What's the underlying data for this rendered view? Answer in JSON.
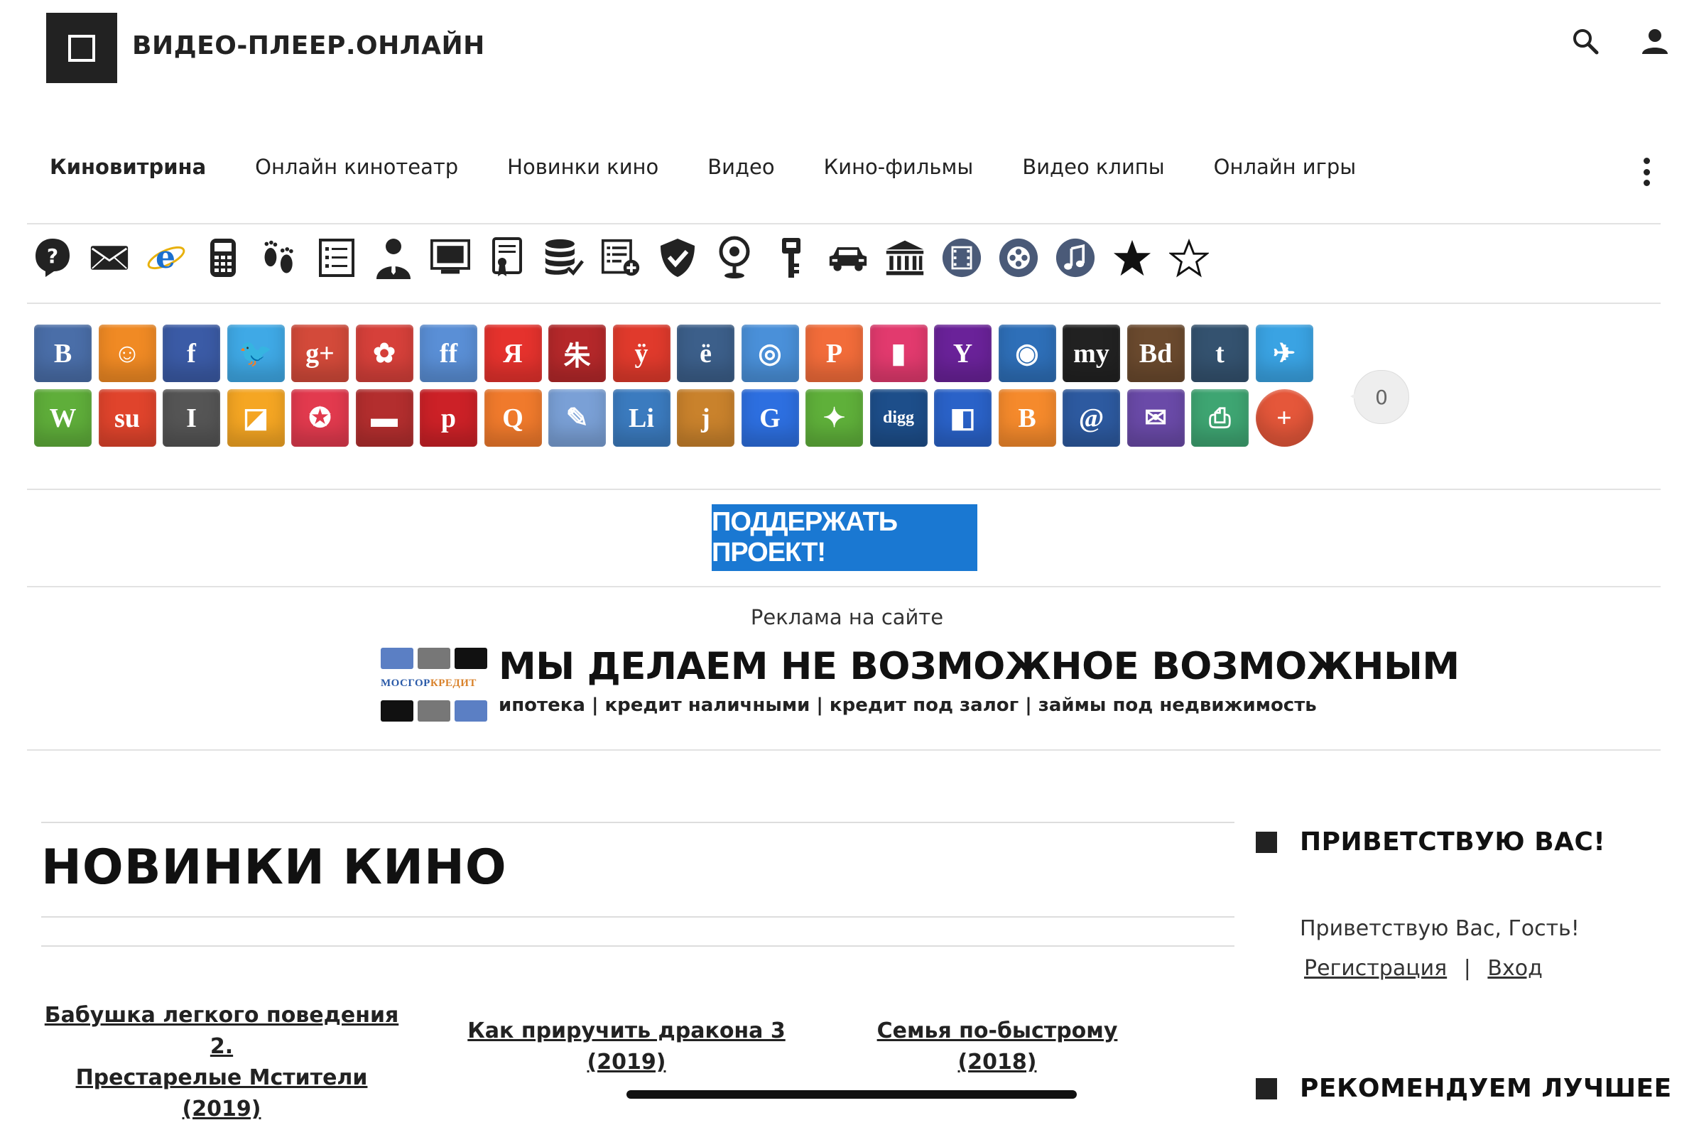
{
  "header": {
    "site_title": "ВИДЕО-ПЛЕЕР.ОНЛАЙН",
    "search_icon": "search-icon",
    "user_icon": "user-icon"
  },
  "nav": {
    "items": [
      "Киновитрина",
      "Онлайн кинотеатр",
      "Новинки кино",
      "Видео",
      "Кино-фильмы",
      "Видео клипы",
      "Онлайн игры"
    ],
    "active": "Киновитрина"
  },
  "tools": [
    "help-icon",
    "mail-icon",
    "ie-icon",
    "calculator-icon",
    "footprints-icon",
    "list-icon",
    "person-icon",
    "monitor-icon",
    "certificate-icon",
    "database-icon",
    "list-add-icon",
    "check-shield-icon",
    "location-icon",
    "key-icon",
    "car-icon",
    "bank-icon",
    "film-icon",
    "reel-icon",
    "music-icon",
    "star-filled-icon",
    "star-outline-icon"
  ],
  "share": {
    "buttons": [
      {
        "name": "vkontakte",
        "glyph": "B",
        "color": "#4a6ea8"
      },
      {
        "name": "odnoklassniki",
        "glyph": "☺",
        "color": "#f08a24"
      },
      {
        "name": "facebook",
        "glyph": "f",
        "color": "#3b5ba6"
      },
      {
        "name": "twitter",
        "glyph": "🐦",
        "color": "#3fa9e6"
      },
      {
        "name": "google-plus",
        "glyph": "g+",
        "color": "#d34a3a"
      },
      {
        "name": "moi-mir",
        "glyph": "✿",
        "color": "#d6403a"
      },
      {
        "name": "friendfeed",
        "glyph": "ff",
        "color": "#5a8fd6"
      },
      {
        "name": "yandex",
        "glyph": "Я",
        "color": "#e5322d"
      },
      {
        "name": "surfingbird",
        "glyph": "朱",
        "color": "#b5282a"
      },
      {
        "name": "liveinternet",
        "glyph": "ÿ",
        "color": "#e03a2c"
      },
      {
        "name": "yo",
        "glyph": "ё",
        "color": "#3c5f8a"
      },
      {
        "name": "evernote-web",
        "glyph": "◎",
        "color": "#4a90d9"
      },
      {
        "name": "pinme",
        "glyph": "P",
        "color": "#f26c3a"
      },
      {
        "name": "bookmark",
        "glyph": "▮",
        "color": "#e23a6e"
      },
      {
        "name": "yahoo",
        "glyph": "Y",
        "color": "#6a2299"
      },
      {
        "name": "webmoney",
        "glyph": "◉",
        "color": "#2e6fb8"
      },
      {
        "name": "my",
        "glyph": "my",
        "color": "#222222"
      },
      {
        "name": "bobrdobr",
        "glyph": "Bd",
        "color": "#6b4a2e"
      },
      {
        "name": "tumblr",
        "glyph": "t",
        "color": "#34526f"
      },
      {
        "name": "hitomi",
        "glyph": "✈",
        "color": "#3aa3e3"
      },
      {
        "name": "wordpress",
        "glyph": "W",
        "color": "#5fae3a"
      },
      {
        "name": "stumbleupon",
        "glyph": "su",
        "color": "#e0442c"
      },
      {
        "name": "instapaper",
        "glyph": "I",
        "color": "#555555"
      },
      {
        "name": "feed",
        "glyph": "◪",
        "color": "#f5a623"
      },
      {
        "name": "circle-star",
        "glyph": "✪",
        "color": "#e23a4e"
      },
      {
        "name": "sofa",
        "glyph": "▬",
        "color": "#b32e2e"
      },
      {
        "name": "pinterest",
        "glyph": "p",
        "color": "#cc2127"
      },
      {
        "name": "search-q",
        "glyph": "Q",
        "color": "#f07a2c"
      },
      {
        "name": "pencil",
        "glyph": "✎",
        "color": "#7aa0d6"
      },
      {
        "name": "linkedin",
        "glyph": "Li",
        "color": "#3b7bbf"
      },
      {
        "name": "juick",
        "glyph": "j",
        "color": "#c9822c"
      },
      {
        "name": "google",
        "glyph": "G",
        "color": "#2d6fe0"
      },
      {
        "name": "evernote",
        "glyph": "✦",
        "color": "#5fb03a"
      },
      {
        "name": "digg",
        "glyph": "digg",
        "color": "#1d4e8a"
      },
      {
        "name": "delicious",
        "glyph": "◧",
        "color": "#2a62c8"
      },
      {
        "name": "blogger",
        "glyph": "B",
        "color": "#f58a2c"
      },
      {
        "name": "email-at",
        "glyph": "@",
        "color": "#2d5aa0"
      },
      {
        "name": "mail",
        "glyph": "✉",
        "color": "#6a4aa8"
      },
      {
        "name": "print",
        "glyph": "⎙",
        "color": "#3ea572"
      },
      {
        "name": "more",
        "glyph": "+",
        "color": "#e5573a"
      }
    ],
    "count": "0"
  },
  "support_button": "ПОДДЕРЖАТЬ ПРОЕКТ!",
  "ad": {
    "label": "Реклама на сайте",
    "brand_part1": "МОСГОР",
    "brand_part2": "КРЕДИТ",
    "headline": "МЫ ДЕЛАЕМ НЕ ВОЗМОЖНОЕ ВОЗМОЖНЫМ",
    "subline": "ипотека | кредит наличными | кредит под залог | займы под недвижимость"
  },
  "main": {
    "title": "НОВИНКИ КИНО",
    "movies": [
      {
        "line1": "Бабушка легкого поведения 2.",
        "line2": "Престарелые Мстители (2019)"
      },
      {
        "line1": "Как приручить дракона 3 (2019)",
        "line2": ""
      },
      {
        "line1": "Семья по-быстрому (2018)",
        "line2": ""
      }
    ]
  },
  "sidebar": {
    "welcome_heading": "ПРИВЕТСТВУЮ ВАС!",
    "welcome_text": "Приветствую Вас, Гость!",
    "register": "Регистрация",
    "separator": "|",
    "login": "Вход",
    "recommend_heading": "РЕКОМЕНДУЕМ ЛУЧШЕЕ"
  }
}
